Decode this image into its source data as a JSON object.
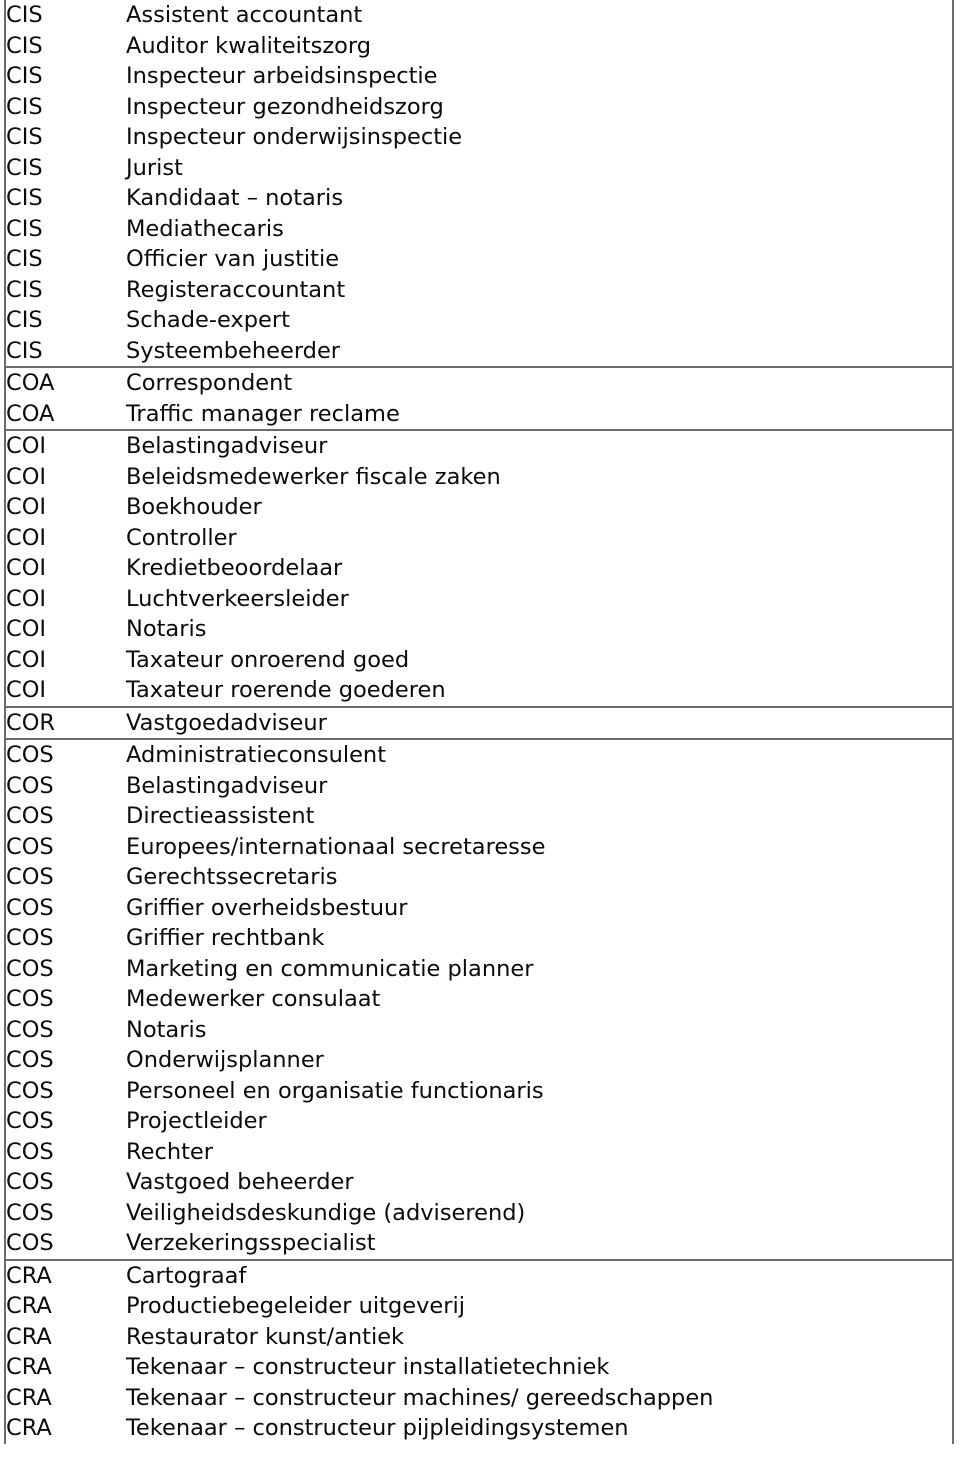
{
  "document": {
    "type": "table",
    "columns": [
      "code",
      "title"
    ],
    "colors": {
      "text": "#0b0b0b",
      "rule": "#6b6b6b",
      "background": "#ffffff"
    },
    "rows": [
      {
        "code": "CIS",
        "title": "Assistent accountant",
        "group_start": false
      },
      {
        "code": "CIS",
        "title": "Auditor kwaliteitszorg",
        "group_start": false
      },
      {
        "code": "CIS",
        "title": "Inspecteur arbeidsinspectie",
        "group_start": false
      },
      {
        "code": "CIS",
        "title": "Inspecteur gezondheidszorg",
        "group_start": false
      },
      {
        "code": "CIS",
        "title": "Inspecteur onderwijsinspectie",
        "group_start": false
      },
      {
        "code": "CIS",
        "title": "Jurist",
        "group_start": false
      },
      {
        "code": "CIS",
        "title": "Kandidaat – notaris",
        "group_start": false
      },
      {
        "code": "CIS",
        "title": "Mediathecaris",
        "group_start": false
      },
      {
        "code": "CIS",
        "title": "Officier van justitie",
        "group_start": false
      },
      {
        "code": "CIS",
        "title": "Registeraccountant",
        "group_start": false
      },
      {
        "code": "CIS",
        "title": "Schade-expert",
        "group_start": false
      },
      {
        "code": "CIS",
        "title": "Systeembeheerder",
        "group_start": false
      },
      {
        "code": "COA",
        "title": "Correspondent",
        "group_start": true
      },
      {
        "code": "COA",
        "title": "Traffic manager reclame",
        "group_start": false
      },
      {
        "code": "COI",
        "title": "Belastingadviseur",
        "group_start": true
      },
      {
        "code": "COI",
        "title": "Beleidsmedewerker fiscale zaken",
        "group_start": false
      },
      {
        "code": "COI",
        "title": "Boekhouder",
        "group_start": false
      },
      {
        "code": "COI",
        "title": "Controller",
        "group_start": false
      },
      {
        "code": "COI",
        "title": "Kredietbeoordelaar",
        "group_start": false
      },
      {
        "code": "COI",
        "title": "Luchtverkeersleider",
        "group_start": false
      },
      {
        "code": "COI",
        "title": "Notaris",
        "group_start": false
      },
      {
        "code": "COI",
        "title": "Taxateur onroerend goed",
        "group_start": false
      },
      {
        "code": "COI",
        "title": "Taxateur roerende goederen",
        "group_start": false
      },
      {
        "code": "COR",
        "title": "Vastgoedadviseur",
        "group_start": true
      },
      {
        "code": "COS",
        "title": "Administratieconsulent",
        "group_start": true
      },
      {
        "code": "COS",
        "title": "Belastingadviseur",
        "group_start": false
      },
      {
        "code": "COS",
        "title": "Directieassistent",
        "group_start": false
      },
      {
        "code": "COS",
        "title": "Europees/internationaal secretaresse",
        "group_start": false
      },
      {
        "code": "COS",
        "title": "Gerechtssecretaris",
        "group_start": false
      },
      {
        "code": "COS",
        "title": "Griffier overheidsbestuur",
        "group_start": false
      },
      {
        "code": "COS",
        "title": "Griffier rechtbank",
        "group_start": false
      },
      {
        "code": "COS",
        "title": "Marketing en communicatie planner",
        "group_start": false
      },
      {
        "code": "COS",
        "title": "Medewerker consulaat",
        "group_start": false
      },
      {
        "code": "COS",
        "title": "Notaris",
        "group_start": false
      },
      {
        "code": "COS",
        "title": "Onderwijsplanner",
        "group_start": false
      },
      {
        "code": "COS",
        "title": "Personeel en organisatie functionaris",
        "group_start": false
      },
      {
        "code": "COS",
        "title": "Projectleider",
        "group_start": false
      },
      {
        "code": "COS",
        "title": "Rechter",
        "group_start": false
      },
      {
        "code": "COS",
        "title": "Vastgoed beheerder",
        "group_start": false
      },
      {
        "code": "COS",
        "title": "Veiligheidsdeskundige (adviserend)",
        "group_start": false
      },
      {
        "code": "COS",
        "title": "Verzekeringsspecialist",
        "group_start": false
      },
      {
        "code": "CRA",
        "title": "Cartograaf",
        "group_start": true
      },
      {
        "code": "CRA",
        "title": "Productiebegeleider uitgeverij",
        "group_start": false
      },
      {
        "code": "CRA",
        "title": "Restaurator kunst/antiek",
        "group_start": false
      },
      {
        "code": "CRA",
        "title": "Tekenaar – constructeur installatietechniek",
        "group_start": false
      },
      {
        "code": "CRA",
        "title": "Tekenaar – constructeur machines/ gereedschappen",
        "group_start": false
      },
      {
        "code": "CRA",
        "title": "Tekenaar – constructeur pijpleidingsystemen",
        "group_start": false
      }
    ]
  }
}
